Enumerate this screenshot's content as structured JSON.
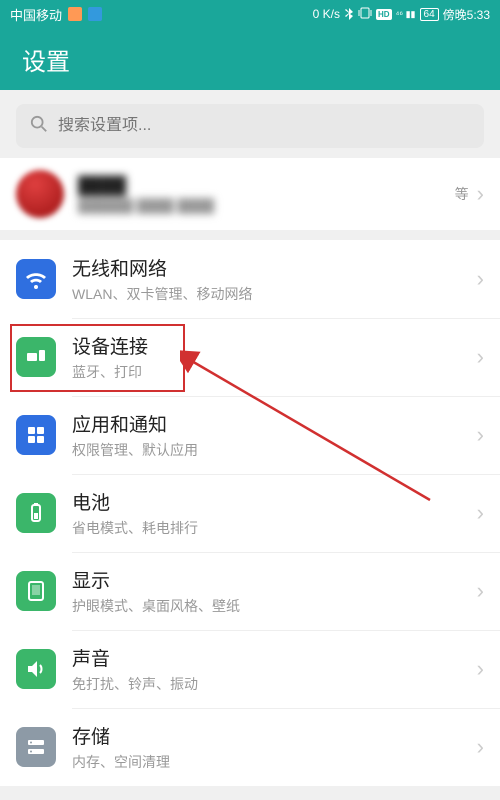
{
  "status": {
    "carrier": "中国移动",
    "speed": "0 K/s",
    "battery": "64",
    "time": "傍晚5:33"
  },
  "header": {
    "title": "设置"
  },
  "search": {
    "placeholder": "搜索设置项..."
  },
  "account": {
    "tail": "等"
  },
  "items": [
    {
      "icon": "wifi",
      "title": "无线和网络",
      "sub": "WLAN、双卡管理、移动网络"
    },
    {
      "icon": "device",
      "title": "设备连接",
      "sub": "蓝牙、打印"
    },
    {
      "icon": "apps",
      "title": "应用和通知",
      "sub": "权限管理、默认应用"
    },
    {
      "icon": "battery",
      "title": "电池",
      "sub": "省电模式、耗电排行"
    },
    {
      "icon": "display",
      "title": "显示",
      "sub": "护眼模式、桌面风格、壁纸"
    },
    {
      "icon": "sound",
      "title": "声音",
      "sub": "免打扰、铃声、振动"
    },
    {
      "icon": "storage",
      "title": "存储",
      "sub": "内存、空间清理"
    }
  ],
  "annotation": {
    "highlighted_index": 1
  }
}
